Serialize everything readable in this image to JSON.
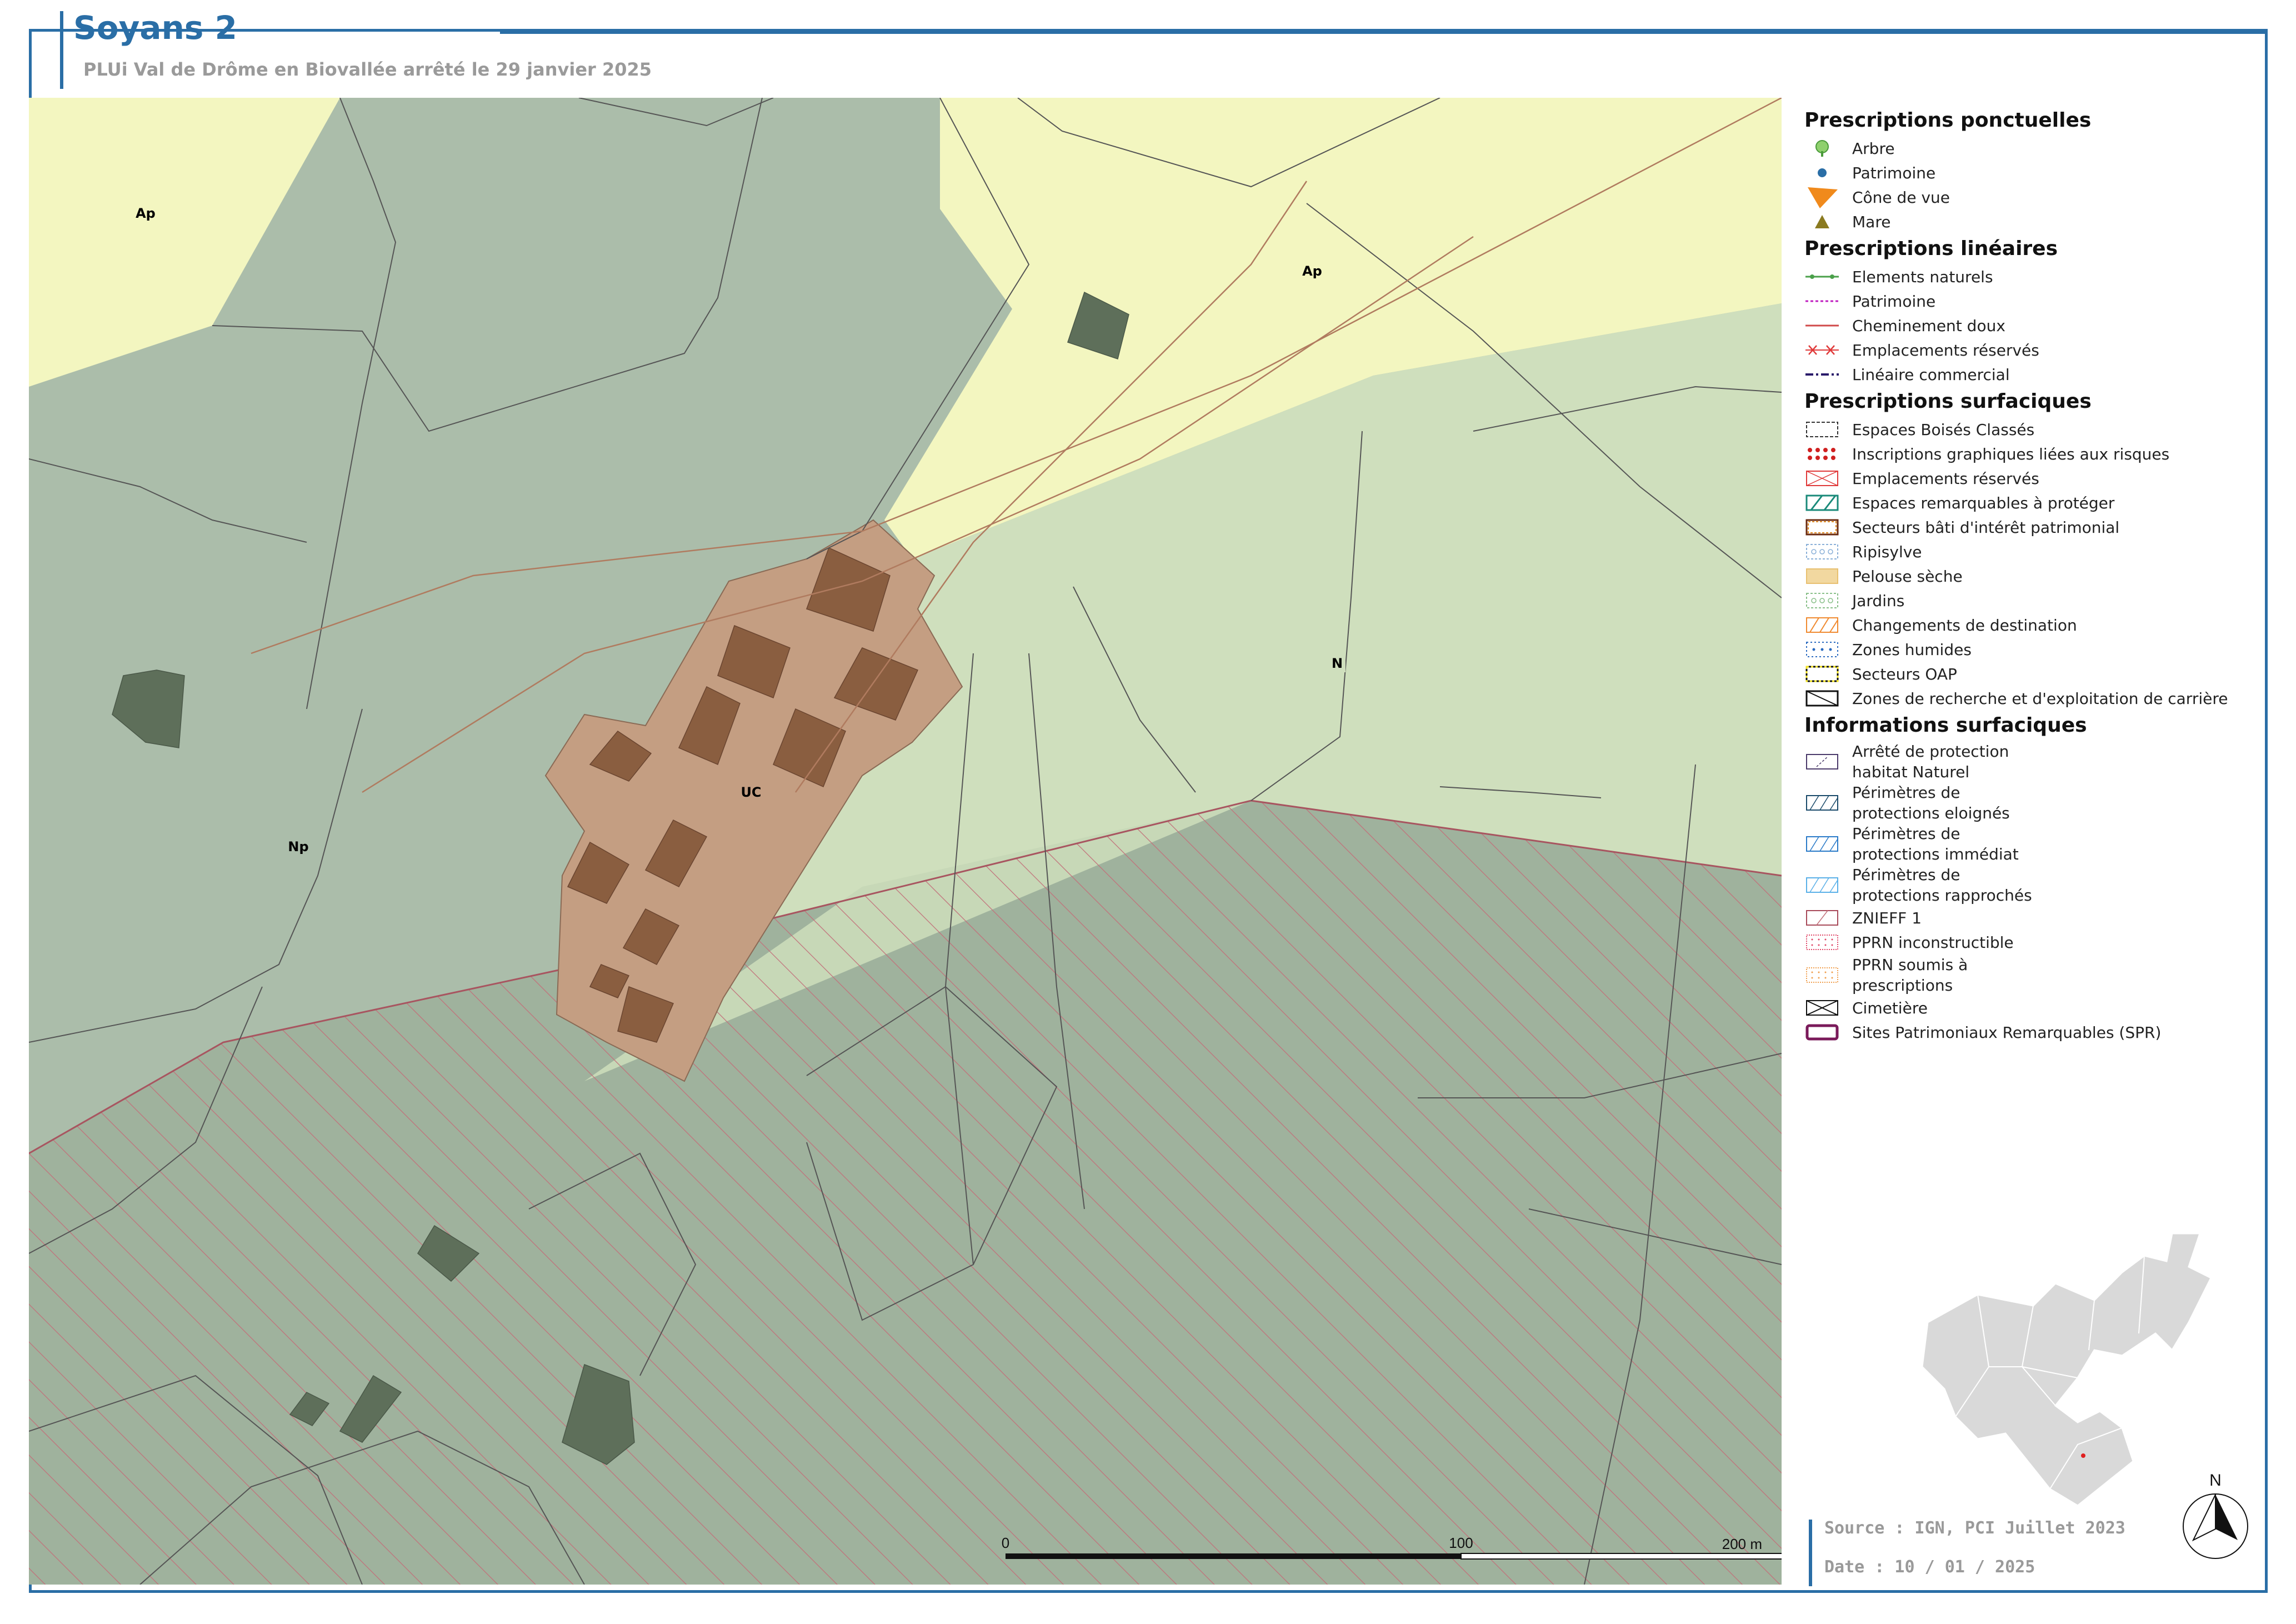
{
  "header": {
    "title": "Soyans 2",
    "subtitle": "PLUi Val de Drôme en Biovallée arrêté le 29 janvier 2025"
  },
  "map": {
    "zone_labels": [
      "Ap",
      "Ap",
      "Np",
      "UC",
      "N"
    ],
    "colors": {
      "zone_a": "#f3f6c0",
      "zone_n_light": "#cfdfbd",
      "zone_n_dark": "#abbdaa",
      "zone_n_hatched": "#9fb29d",
      "zone_uc": "#c49e82",
      "building": "#8a5e40",
      "building_green": "#5e6f5a",
      "znieff_hatch": "#c2707a"
    }
  },
  "legend": {
    "ponctuelles": {
      "title": "Prescriptions ponctuelles",
      "items": [
        "Arbre",
        "Patrimoine",
        "Cône de vue",
        "Mare"
      ]
    },
    "lineaires": {
      "title": "Prescriptions linéaires",
      "items": [
        "Elements naturels",
        "Patrimoine",
        "Cheminement doux",
        "Emplacements réservés",
        "Linéaire commercial"
      ]
    },
    "surfaciques": {
      "title": "Prescriptions surfaciques",
      "items": [
        "Espaces Boisés Classés",
        "Inscriptions graphiques liées aux risques",
        "Emplacements réservés",
        "Espaces remarquables à protéger",
        "Secteurs bâti d'intérêt patrimonial",
        "Ripisylve",
        "Pelouse sèche",
        "Jardins",
        "Changements de destination",
        "Zones humides",
        "Secteurs OAP",
        "Zones de recherche et d'exploitation de carrière"
      ]
    },
    "informations": {
      "title": "Informations surfaciques",
      "items": [
        "Arrêté de protection habitat Naturel",
        "Périmètres de protections eloignés",
        "Périmètres de protections immédiat",
        "Périmètres de protections rapprochés",
        "ZNIEFF 1",
        "PPRN inconstructible",
        "PPRN soumis à prescriptions",
        "Cimetière",
        "Sites Patrimoniaux Remarquables (SPR)"
      ]
    }
  },
  "scale": {
    "tick_0": "0",
    "tick_100": "100",
    "tick_200": "200 m"
  },
  "footer": {
    "source": "Source : IGN, PCI Juillet 2023",
    "date": "Date : 10 / 01 / 2025"
  },
  "north_label": "N"
}
